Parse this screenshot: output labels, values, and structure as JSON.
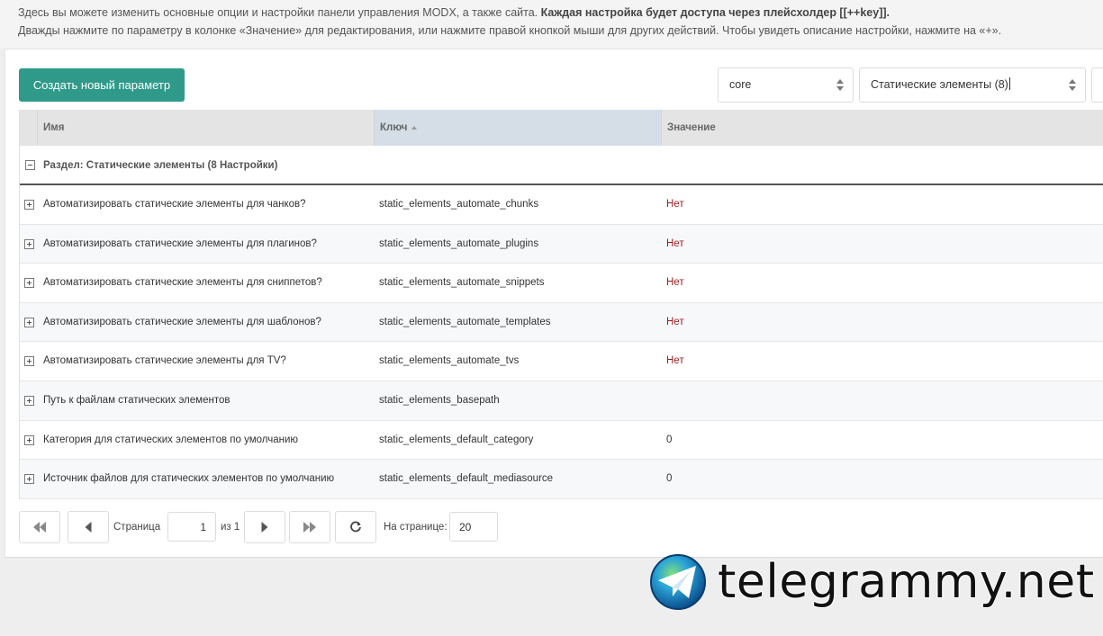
{
  "intro": {
    "line1_plain": "Здесь вы можете изменить основные опции и настройки панели управления MODX, а также сайта. ",
    "line1_bold": "Каждая настройка будет доступа через плейсхолдер [[++key]].",
    "line2": "Дважды нажмите по параметру в колонке «Значение» для редактирования, или нажмите правой кнопкой мыши для других действий. Чтобы увидеть описание настройки, нажмите на «+»."
  },
  "toolbar": {
    "create_label": "Создать новый параметр",
    "namespace_value": "core",
    "area_value": "Статические элементы (8)"
  },
  "grid": {
    "columns": {
      "name": "Имя",
      "key": "Ключ",
      "value": "Значение"
    },
    "group_title": "Раздел: Статические элементы (8 Настройки)",
    "rows": [
      {
        "name": "Автоматизировать статические элементы для чанков?",
        "key": "static_elements_automate_chunks",
        "value": "Нет"
      },
      {
        "name": "Автоматизировать статические элементы для плагинов?",
        "key": "static_elements_automate_plugins",
        "value": "Нет"
      },
      {
        "name": "Автоматизировать статические элементы для сниппетов?",
        "key": "static_elements_automate_snippets",
        "value": "Нет"
      },
      {
        "name": "Автоматизировать статические элементы для шаблонов?",
        "key": "static_elements_automate_templates",
        "value": "Нет"
      },
      {
        "name": "Автоматизировать статические элементы для TV?",
        "key": "static_elements_automate_tvs",
        "value": "Нет"
      },
      {
        "name": "Путь к файлам статических элементов",
        "key": "static_elements_basepath",
        "value": ""
      },
      {
        "name": "Категория для статических элементов по умолчанию",
        "key": "static_elements_default_category",
        "value": "0"
      },
      {
        "name": "Источник файлов для статических элементов по умолчанию",
        "key": "static_elements_default_mediasource",
        "value": "0"
      }
    ]
  },
  "pager": {
    "page_label": "Страница",
    "page_value": "1",
    "of_label": "из 1",
    "per_page_label": "На странице:",
    "per_page_value": "20"
  },
  "icons": [
    "first-page-icon",
    "prev-page-icon",
    "next-page-icon",
    "last-page-icon",
    "refresh-icon",
    "expand-icon",
    "collapse-icon",
    "sort-asc-icon",
    "select-arrows-icon"
  ],
  "colors": {
    "accent": "#2f9a8a",
    "negative_value": "#9b1c1c",
    "sorted_column": "#d5dee6"
  },
  "watermark": {
    "text": "telegrammy.net"
  }
}
